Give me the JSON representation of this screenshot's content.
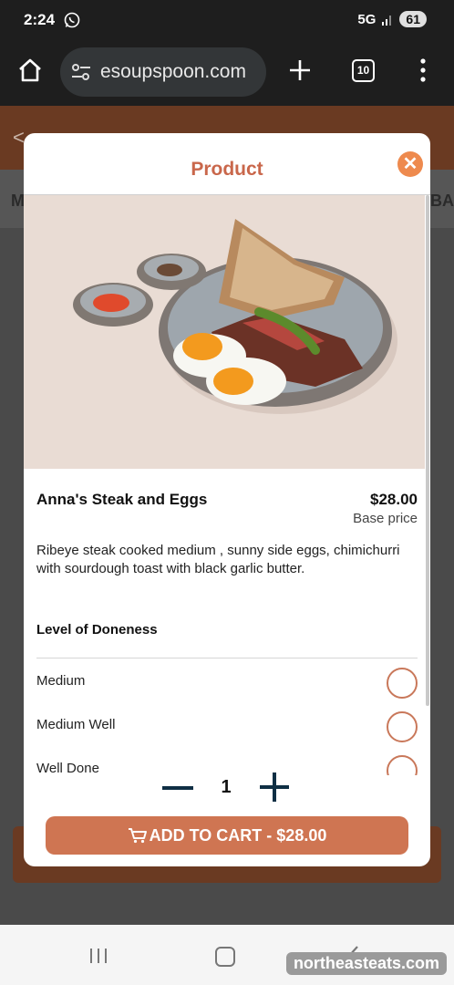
{
  "status_bar": {
    "time": "2:24",
    "network": "5G",
    "battery": "61"
  },
  "browser": {
    "url": "esoupspoon.com",
    "tab_count": "10"
  },
  "background": {
    "back_glyph": "<",
    "tab_left": "M",
    "tab_right": "BA"
  },
  "modal": {
    "title": "Product",
    "close_glyph": "✕",
    "product": {
      "name": "Anna's Steak and Eggs",
      "price": "$28.00",
      "price_note": "Base price",
      "description": "Ribeye steak cooked medium , sunny side eggs, chimichurri with sourdough toast with black garlic butter."
    },
    "option_group": {
      "heading": "Level of Doneness",
      "options": [
        {
          "label": "Medium",
          "selected": false
        },
        {
          "label": "Medium Well",
          "selected": false
        },
        {
          "label": "Well Done",
          "selected": false
        }
      ]
    },
    "quantity": "1",
    "add_to_cart_label": "ADD TO CART - $28.00"
  },
  "watermark": "northeasteats.com",
  "colors": {
    "accent": "#cf7552",
    "title": "#c9674b",
    "close": "#ee8a4e",
    "stepper": "#0f2f44"
  }
}
